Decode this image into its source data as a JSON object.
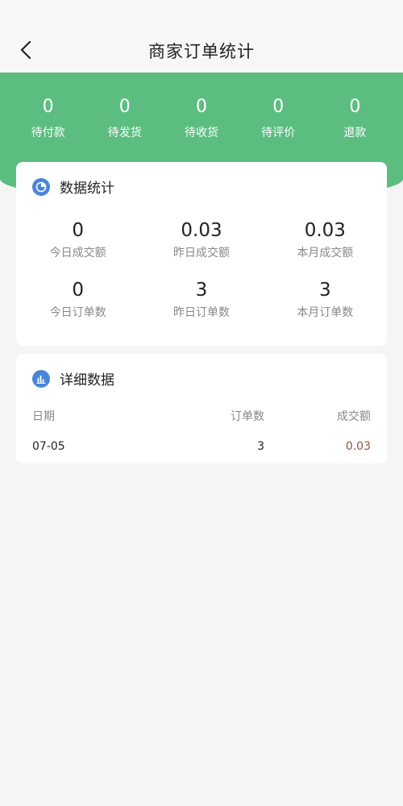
{
  "header": {
    "title": "商家订单统计"
  },
  "status": [
    {
      "count": "0",
      "label": "待付款"
    },
    {
      "count": "0",
      "label": "待发货"
    },
    {
      "count": "0",
      "label": "待收货"
    },
    {
      "count": "0",
      "label": "待评价"
    },
    {
      "count": "0",
      "label": "退款"
    }
  ],
  "stats_card": {
    "title": "数据统计",
    "items": [
      {
        "value": "0",
        "label": "今日成交额"
      },
      {
        "value": "0.03",
        "label": "昨日成交额"
      },
      {
        "value": "0.03",
        "label": "本月成交额"
      },
      {
        "value": "0",
        "label": "今日订单数"
      },
      {
        "value": "3",
        "label": "昨日订单数"
      },
      {
        "value": "3",
        "label": "本月订单数"
      }
    ]
  },
  "detail_card": {
    "title": "详细数据",
    "columns": {
      "date": "日期",
      "count": "订单数",
      "amount": "成交额"
    },
    "rows": [
      {
        "date": "07-05",
        "count": "3",
        "amount": "0.03"
      }
    ]
  },
  "colors": {
    "accent": "#5bbe80",
    "icon_blue": "#4a86d8",
    "amount": "#8b5a4a"
  },
  "icons": {
    "back": "chevron-left-icon",
    "stats": "pie-chart-icon",
    "detail": "bar-chart-icon"
  }
}
